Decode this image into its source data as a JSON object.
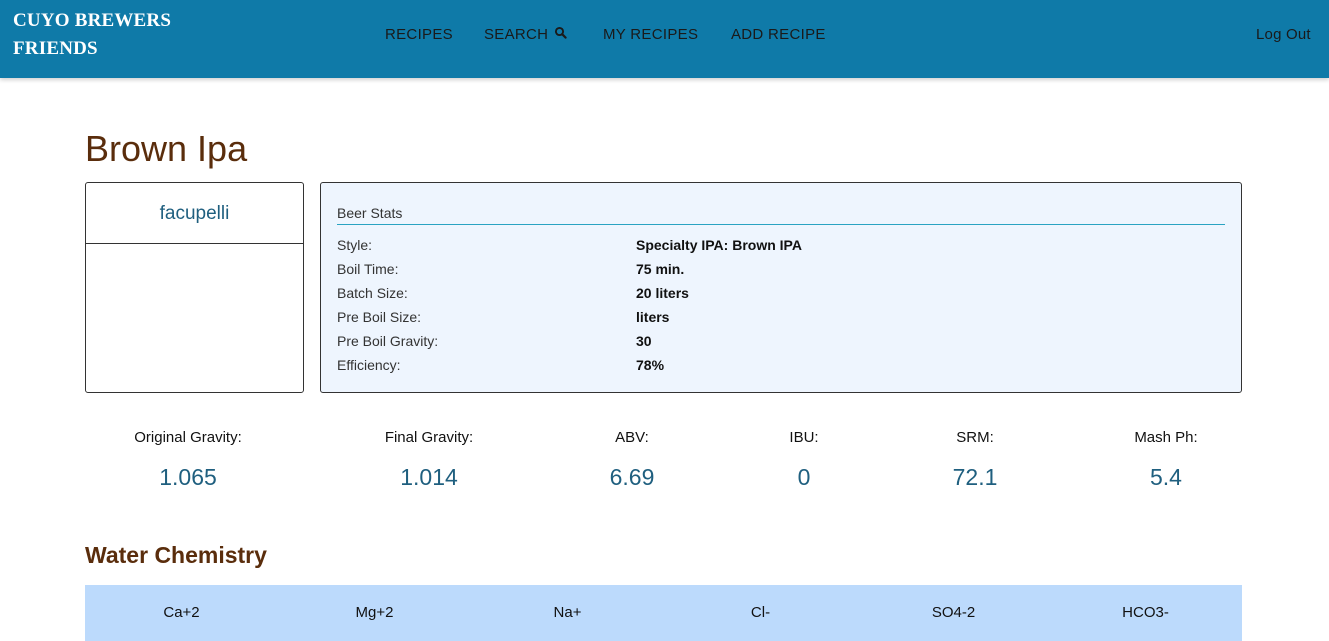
{
  "nav": {
    "brand": "CUYO BREWERS FRIENDS",
    "links": [
      "RECIPES",
      "SEARCH",
      "MY RECIPES",
      "ADD RECIPE"
    ],
    "logout": "Log Out",
    "search_icon": "search-icon",
    "background_color": "#0f7aa8"
  },
  "recipe": {
    "title": "Brown Ipa",
    "author": "facupelli"
  },
  "beer_stats": {
    "heading": "Beer Stats",
    "rows": [
      {
        "label": "Style:",
        "value": "Specialty IPA: Brown IPA"
      },
      {
        "label": "Boil Time:",
        "value": "75 min."
      },
      {
        "label": "Batch Size:",
        "value": "20 liters"
      },
      {
        "label": "Pre Boil Size:",
        "value": "liters"
      },
      {
        "label": "Pre Boil Gravity:",
        "value": "30"
      },
      {
        "label": "Efficiency:",
        "value": "78%"
      }
    ]
  },
  "metrics": [
    {
      "label": "Original Gravity:",
      "value": "1.065"
    },
    {
      "label": "Final Gravity:",
      "value": "1.014"
    },
    {
      "label": "ABV:",
      "value": "6.69"
    },
    {
      "label": "IBU:",
      "value": "0"
    },
    {
      "label": "SRM:",
      "value": "72.1"
    },
    {
      "label": "Mash Ph:",
      "value": "5.4"
    }
  ],
  "water_chemistry": {
    "title": "Water Chemistry",
    "columns": [
      "Ca+2",
      "Mg+2",
      "Na+",
      "Cl-",
      "SO4-2",
      "HCO3-"
    ]
  },
  "colors": {
    "title_brown": "#5a2d0c",
    "value_blue": "#1f5f7f",
    "stats_bg": "#eef5fe",
    "water_header_bg": "#bcdafc"
  }
}
